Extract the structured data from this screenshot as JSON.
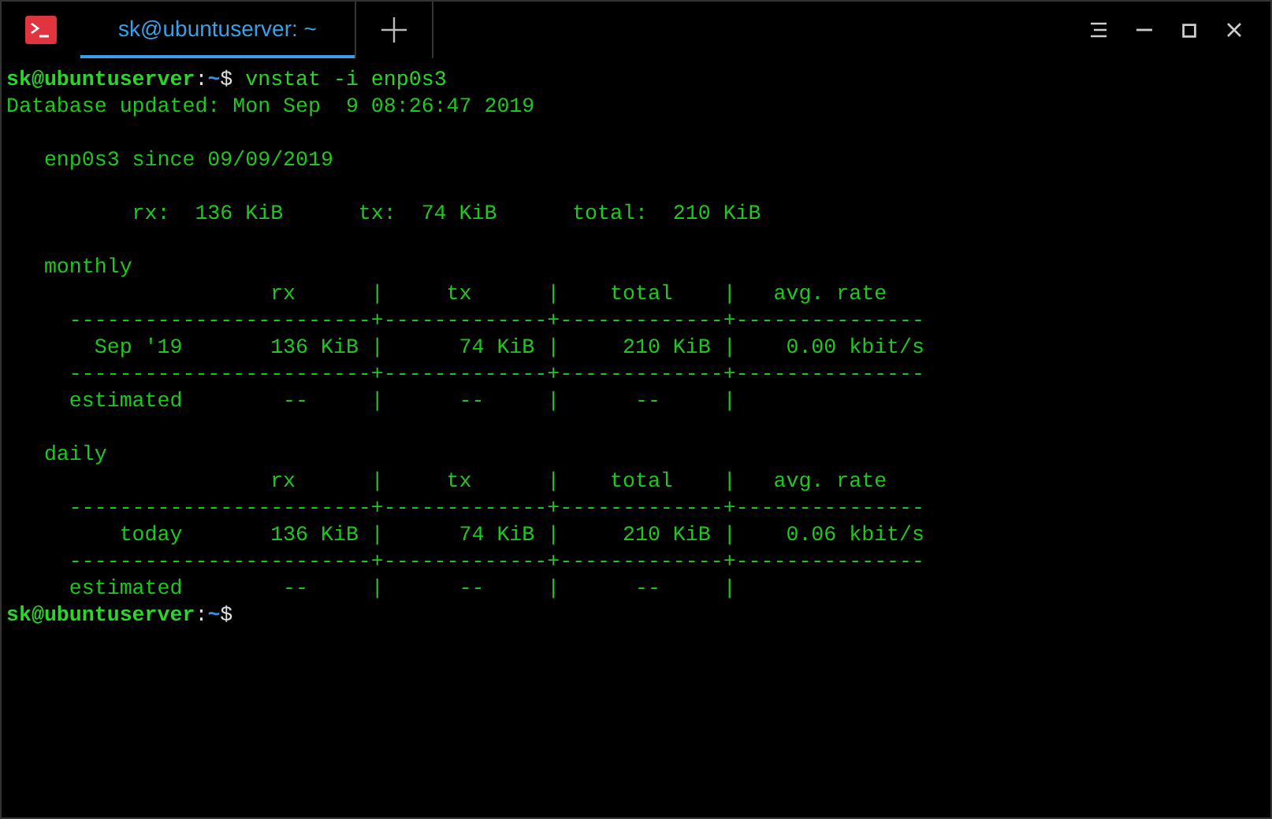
{
  "tabs": [
    {
      "label": "sk@ubuntuserver: ~",
      "selected": true
    }
  ],
  "terminal": [
    {
      "kind": "prompt",
      "user_host": "sk@ubuntuserver",
      "separator": ":",
      "path": "~",
      "symbol": "$",
      "command": " vnstat -i enp0s3"
    },
    {
      "kind": "output",
      "text": "Database updated: Mon Sep  9 08:26:47 2019"
    },
    {
      "kind": "blank"
    },
    {
      "kind": "output",
      "text": "   enp0s3 since 09/09/2019"
    },
    {
      "kind": "blank"
    },
    {
      "kind": "output",
      "text": "          rx:  136 KiB      tx:  74 KiB      total:  210 KiB"
    },
    {
      "kind": "blank"
    },
    {
      "kind": "output",
      "text": "   monthly"
    },
    {
      "kind": "output",
      "text": "                     rx      |     tx      |    total    |   avg. rate"
    },
    {
      "kind": "output",
      "text": "     ------------------------+-------------+-------------+---------------"
    },
    {
      "kind": "output",
      "text": "       Sep '19       136 KiB |      74 KiB |     210 KiB |    0.00 kbit/s"
    },
    {
      "kind": "output",
      "text": "     ------------------------+-------------+-------------+---------------"
    },
    {
      "kind": "output",
      "text": "     estimated        --     |      --     |      --     |"
    },
    {
      "kind": "blank"
    },
    {
      "kind": "output",
      "text": "   daily"
    },
    {
      "kind": "output",
      "text": "                     rx      |     tx      |    total    |   avg. rate"
    },
    {
      "kind": "output",
      "text": "     ------------------------+-------------+-------------+---------------"
    },
    {
      "kind": "output",
      "text": "         today       136 KiB |      74 KiB |     210 KiB |    0.06 kbit/s"
    },
    {
      "kind": "output",
      "text": "     ------------------------+-------------+-------------+---------------"
    },
    {
      "kind": "output",
      "text": "     estimated        --     |      --     |      --     |"
    },
    {
      "kind": "prompt",
      "user_host": "sk@ubuntuserver",
      "separator": ":",
      "path": "~",
      "symbol": "$"
    }
  ]
}
